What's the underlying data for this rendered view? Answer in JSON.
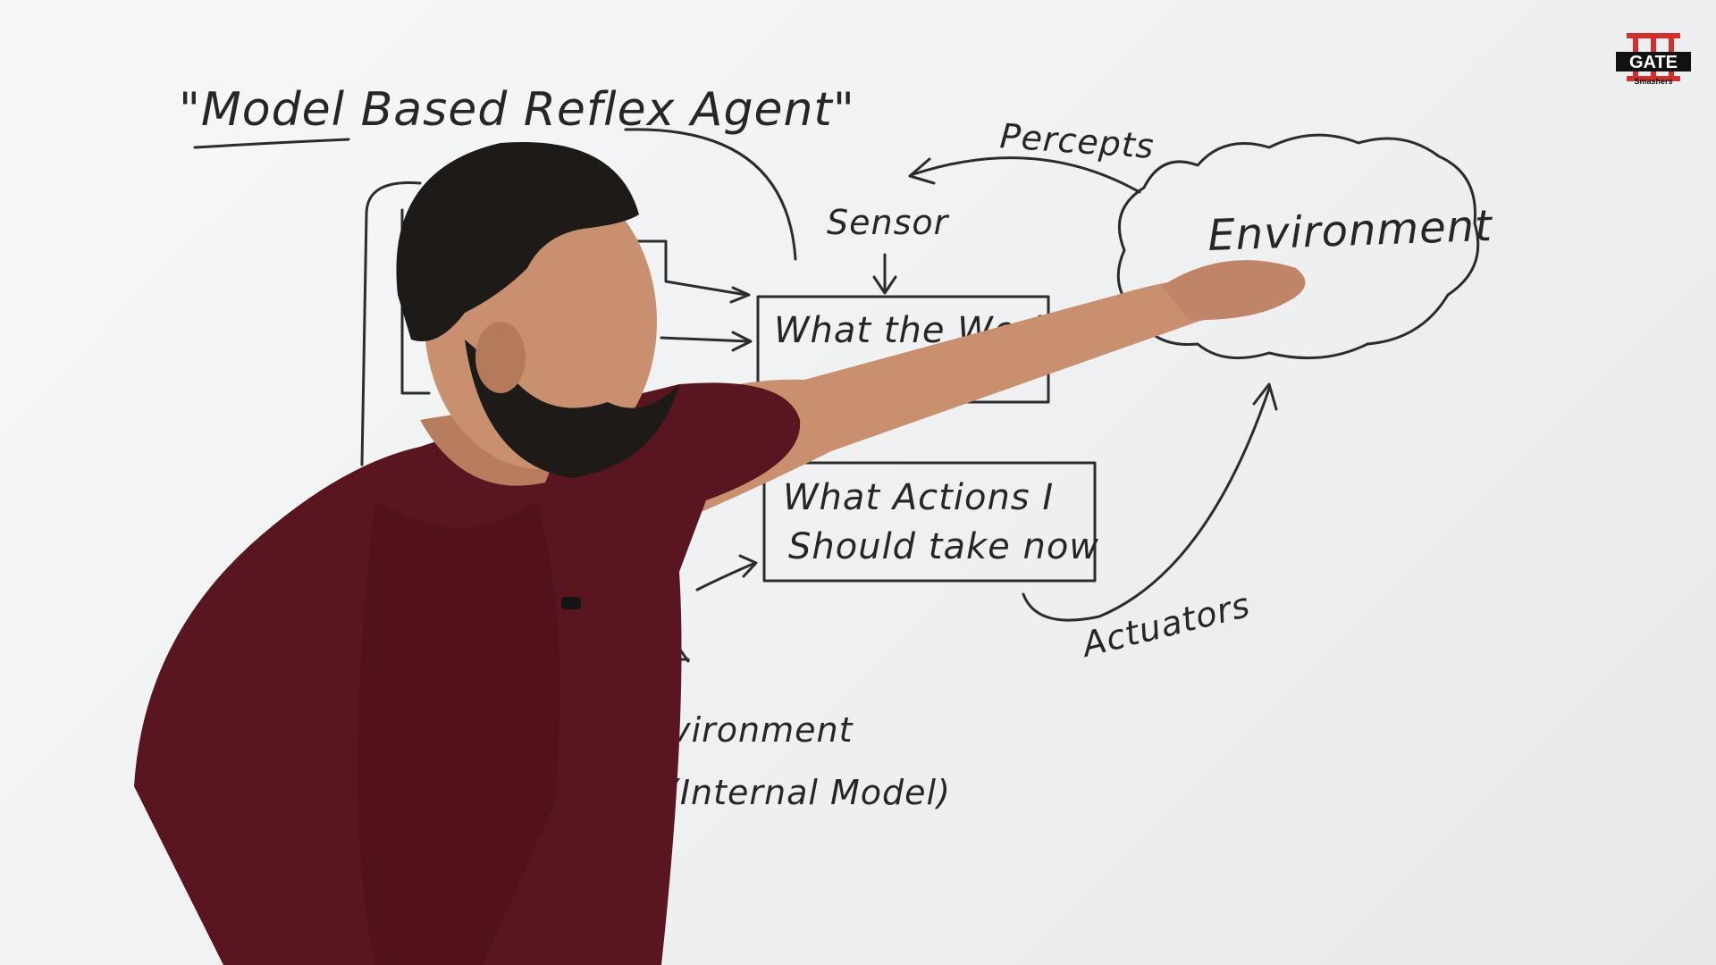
{
  "whiteboard": {
    "title": "\"Model Based Reflex Agent\"",
    "percepts_label": "Percepts",
    "sensor_label": "Sensor",
    "environment_label": "Environment",
    "box_world_line1": "What the World",
    "box_actions_line1": "What Actions I",
    "box_actions_line2": "Should take now",
    "actuators_label": "Actuators",
    "bottom_line1": "Environment",
    "bottom_line2": "(Internal Model)"
  },
  "logo": {
    "main_text": "GATE",
    "sub_text": "Smashers",
    "accent_color": "#d32f2f"
  },
  "presenter": {
    "shirt_color": "#5a1620",
    "skin_color": "#c8906e",
    "hair_color": "#1d1a18"
  }
}
